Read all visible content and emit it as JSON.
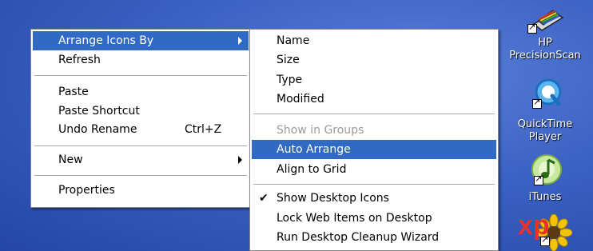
{
  "context_menu": {
    "items": [
      {
        "label": "Arrange Icons By",
        "shortcut": "",
        "has_submenu": true,
        "highlighted": true
      },
      {
        "label": "Refresh"
      },
      {
        "label": "Paste"
      },
      {
        "label": "Paste Shortcut"
      },
      {
        "label": "Undo Rename",
        "shortcut": "Ctrl+Z"
      },
      {
        "label": "New",
        "has_submenu": true
      },
      {
        "label": "Properties"
      }
    ]
  },
  "arrange_submenu": {
    "items": [
      {
        "label": "Name"
      },
      {
        "label": "Size"
      },
      {
        "label": "Type"
      },
      {
        "label": "Modified"
      },
      {
        "label": "Show in Groups",
        "disabled": true
      },
      {
        "label": "Auto Arrange",
        "highlighted": true
      },
      {
        "label": "Align to Grid"
      },
      {
        "label": "Show Desktop Icons",
        "checked": true
      },
      {
        "label": "Lock Web Items on Desktop"
      },
      {
        "label": "Run Desktop Cleanup Wizard"
      }
    ]
  },
  "desktop_icons": [
    {
      "label_line1": "HP",
      "label_line2": "PrecisionScan",
      "icon": "scanner-icon"
    },
    {
      "label_line1": "QuickTime",
      "label_line2": "Player",
      "icon": "quicktime-icon"
    },
    {
      "label_line1": "iTunes",
      "label_line2": "",
      "icon": "itunes-icon"
    },
    {
      "label_line1": "",
      "label_line2": "",
      "icon": "sunflower-icon"
    }
  ],
  "wallpaper_logo": "xp",
  "colors": {
    "highlight": "#316ac5",
    "desktop": "#3a61c4",
    "logo": "#e8312a"
  }
}
